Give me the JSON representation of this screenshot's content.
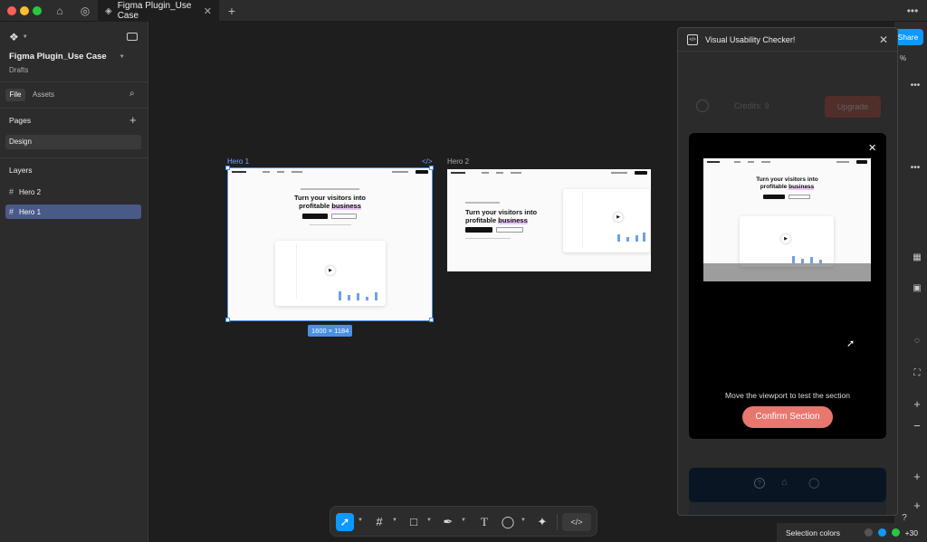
{
  "titlebar": {
    "tab_title": "Figma Plugin_Use Case",
    "traffic_colors": [
      "#fe5f57",
      "#febc2e",
      "#28c840"
    ]
  },
  "sidebar": {
    "file_name": "Figma Plugin_Use Case",
    "file_location": "Drafts",
    "tabs": [
      "File",
      "Assets"
    ],
    "pages_heading": "Pages",
    "pages": [
      "Design"
    ],
    "layers_heading": "Layers",
    "layers": [
      "Hero 2",
      "Hero 1"
    ]
  },
  "canvas": {
    "frame1_label": "Hero 1",
    "frame2_label": "Hero 2",
    "dimension_badge": "1600 × 1184",
    "hero_heading_line1": "Turn your visitors into",
    "hero_heading_line2_pre": "profitable ",
    "hero_heading_line2_highlight": "business"
  },
  "plugin": {
    "title": "Visual Usability Checker!",
    "behind_credits": "Credits: 9",
    "behind_upgrade": "Upgrade",
    "instruction": "Move the viewport to test the section",
    "confirm_button": "Confirm Section"
  },
  "right_panel": {
    "share_label": "Share",
    "selection_colors_label": "Selection colors",
    "more_colors": "+30",
    "percent_label": "%"
  },
  "colors": {
    "accent": "#0d99ff",
    "selection": "#4a90e2",
    "confirm": "#e8776f"
  }
}
